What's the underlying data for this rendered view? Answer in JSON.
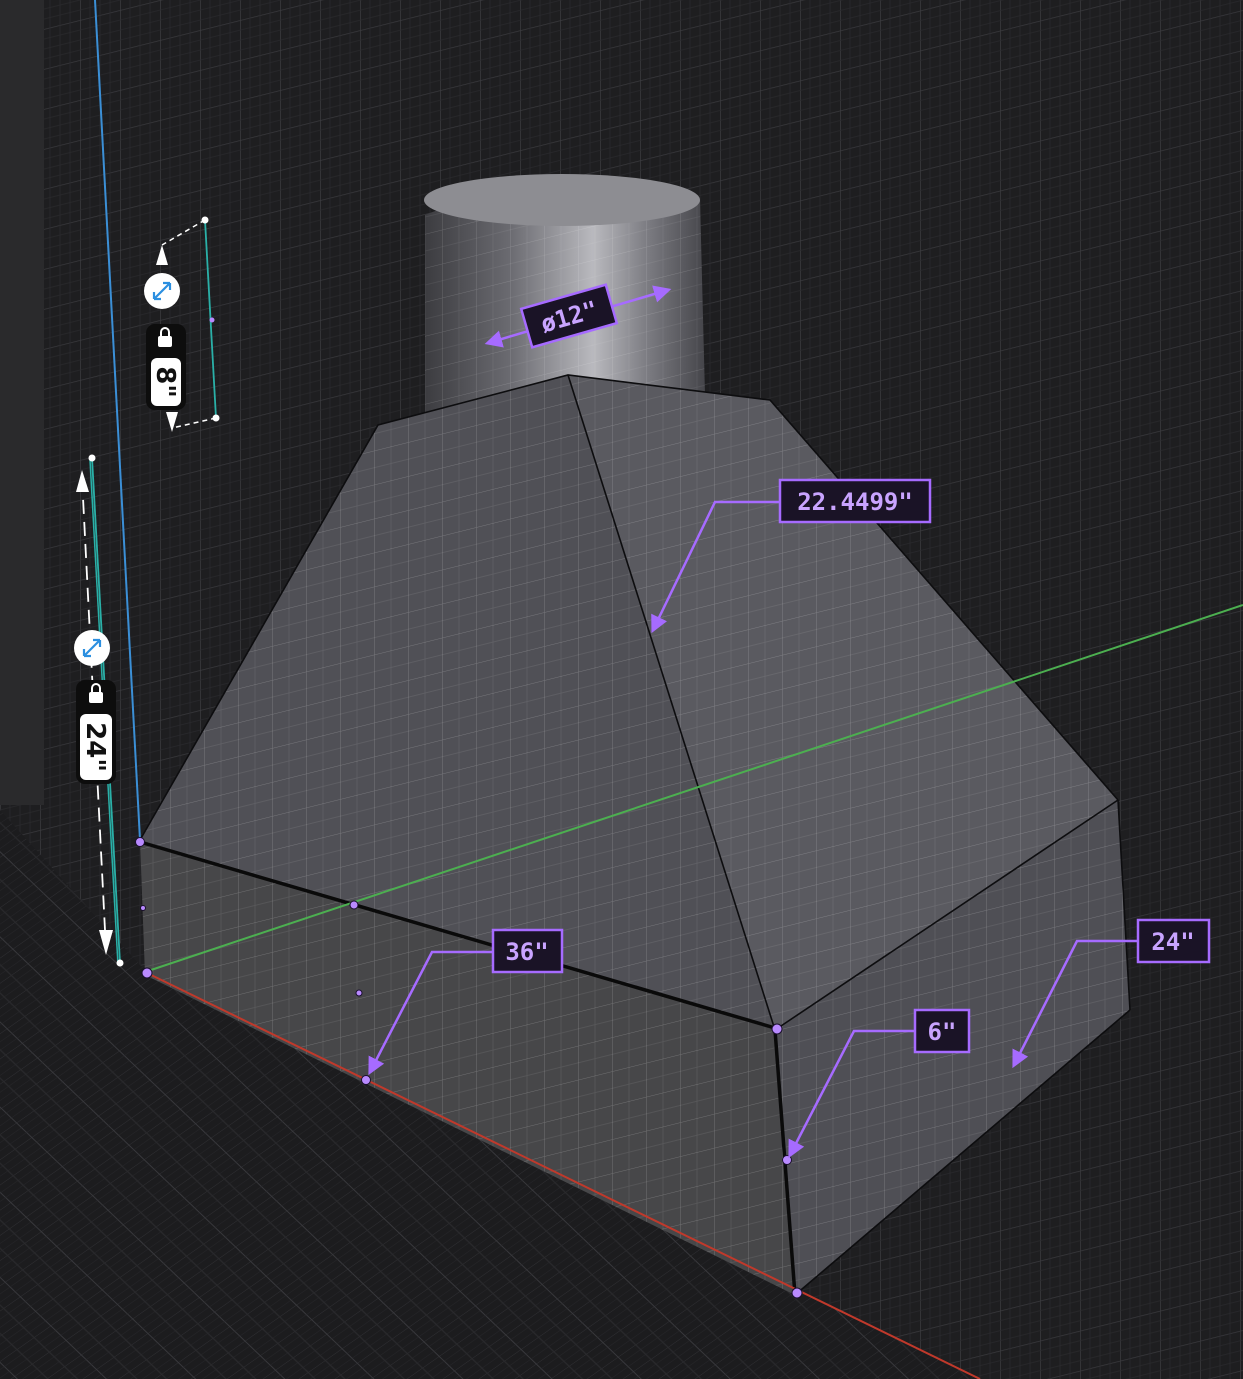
{
  "viewport": {
    "background": "#1b1b1d",
    "accent": "#a66bff",
    "axis_colors": {
      "x_axis": "#c0392b",
      "y_axis": "#4caf50",
      "z_axis": "#3b8fd6"
    }
  },
  "dimensions": {
    "duct_diameter": "ø12\"",
    "slope_length": "22.4499\"",
    "front_width": "36\"",
    "band_height": "6\"",
    "depth": "24\""
  },
  "height_controls": {
    "upper": {
      "value": "8\"",
      "icons": [
        "swap-arrows-icon",
        "lock-icon"
      ]
    },
    "lower": {
      "value": "24\"",
      "icons": [
        "swap-arrows-icon",
        "lock-icon"
      ]
    }
  }
}
